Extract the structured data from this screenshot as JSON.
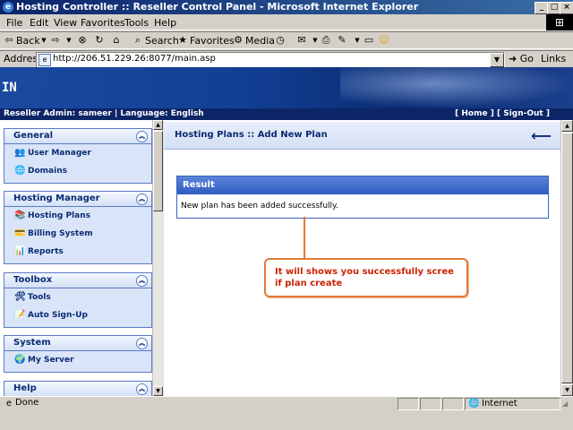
{
  "window": {
    "title": "Hosting Controller :: Reseller Control Panel - Microsoft Internet Explorer",
    "minimize": "_",
    "maximize": "□",
    "close": "×"
  },
  "menu": [
    "File",
    "Edit",
    "View",
    "Favorites",
    "Tools",
    "Help"
  ],
  "toolbar": {
    "back": "Back",
    "search": "Search",
    "favorites": "Favorites",
    "media": "Media"
  },
  "address": {
    "label": "Address",
    "url": "http://206.51.229.26:8077/main.asp",
    "go": "Go",
    "links": "Links"
  },
  "banner": {
    "brand": "IN",
    "info_left": "Reseller Admin: sameer | Language: English",
    "info_right": "[ Home ] [ Sign-Out ]"
  },
  "sidebar": {
    "sections": [
      {
        "title": "General",
        "items": [
          {
            "label": "User Manager",
            "icon": "users-icon"
          },
          {
            "label": "Domains",
            "icon": "domains-icon"
          }
        ]
      },
      {
        "title": "Hosting Manager",
        "items": [
          {
            "label": "Hosting Plans",
            "icon": "plans-icon"
          },
          {
            "label": "Billing System",
            "icon": "billing-icon"
          },
          {
            "label": "Reports",
            "icon": "reports-icon"
          }
        ]
      },
      {
        "title": "Toolbox",
        "items": [
          {
            "label": "Tools",
            "icon": "tools-icon"
          },
          {
            "label": "Auto Sign-Up",
            "icon": "signup-icon"
          }
        ]
      },
      {
        "title": "System",
        "items": [
          {
            "label": "My Server",
            "icon": "server-icon"
          }
        ]
      },
      {
        "title": "Help",
        "items": []
      }
    ]
  },
  "main": {
    "page_title": "Hosting Plans :: Add New Plan",
    "result_title": "Result",
    "result_message": "New plan has been added successfully."
  },
  "annotation": {
    "text": "It will shows you successfully scree if plan create",
    "color": "#e07a3a"
  },
  "status": {
    "left": "Done",
    "zone": "Internet"
  }
}
